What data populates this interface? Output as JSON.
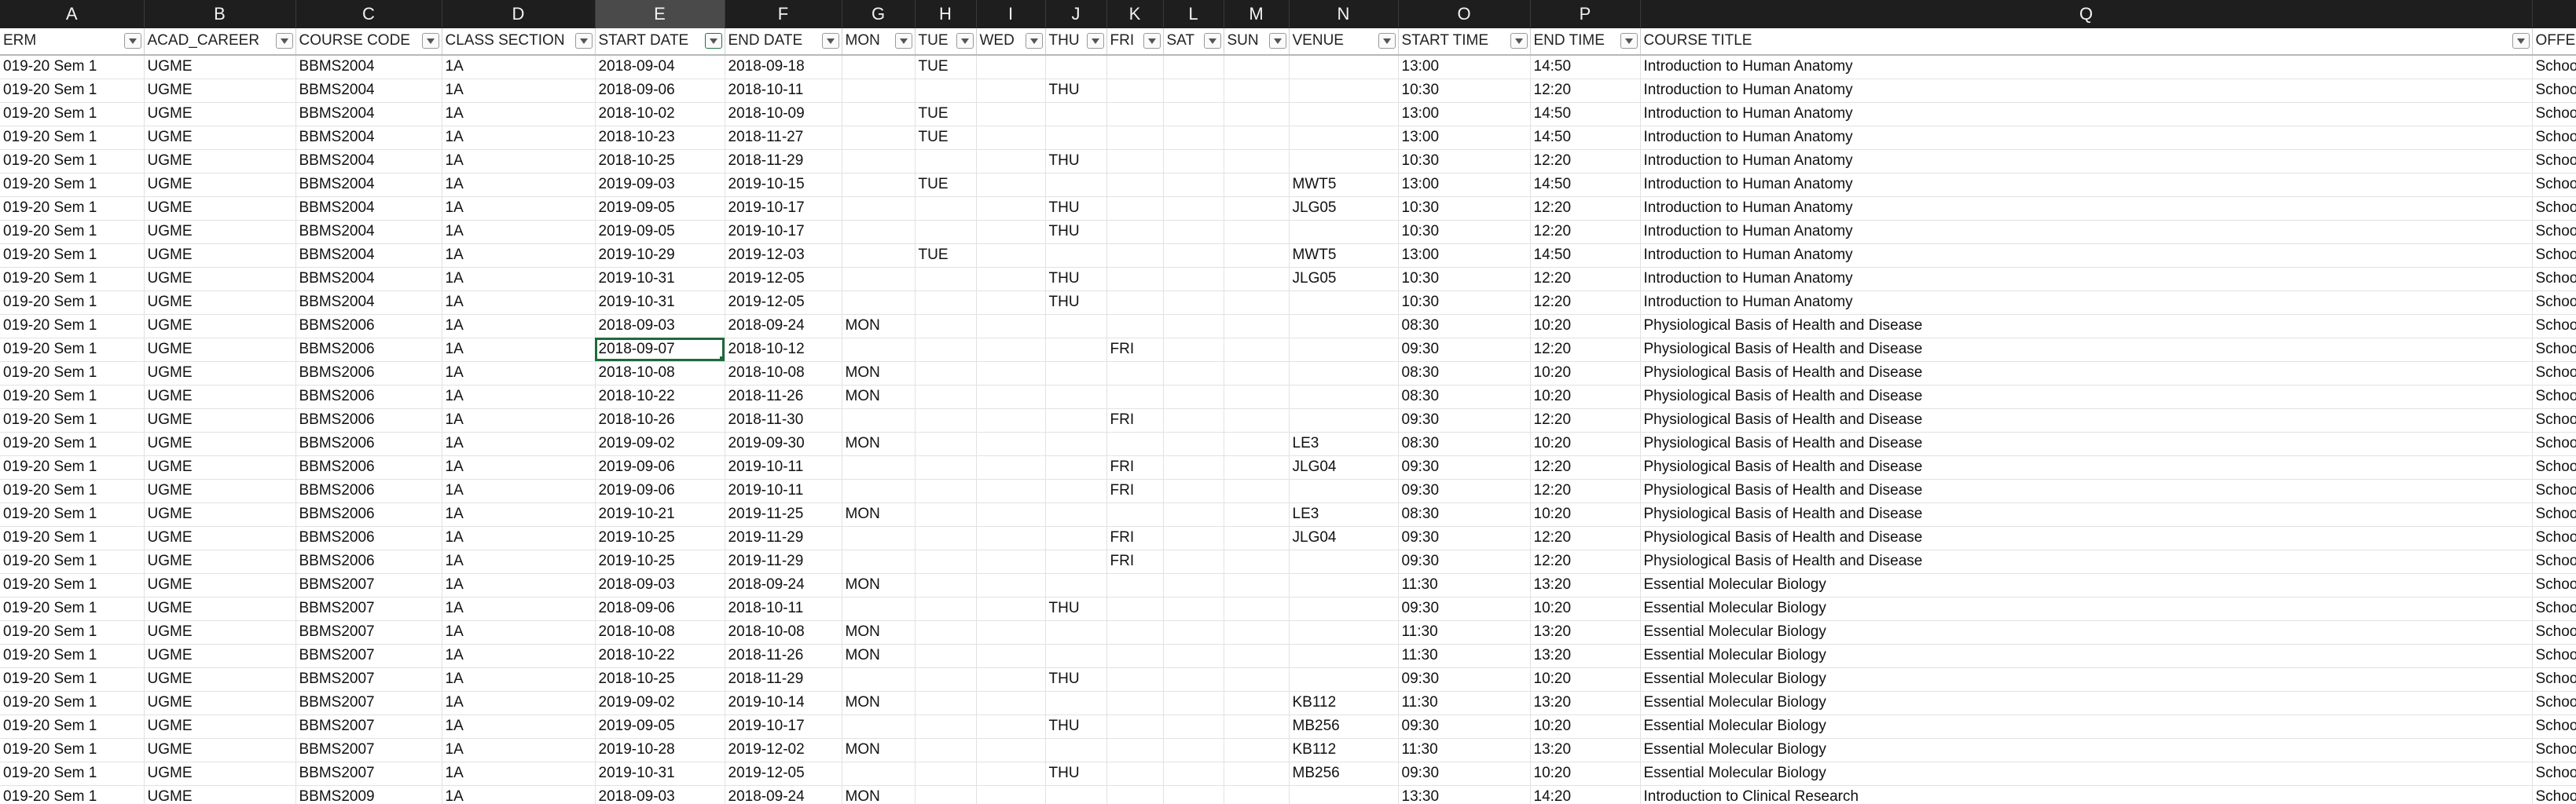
{
  "column_letters": [
    "A",
    "B",
    "C",
    "D",
    "E",
    "F",
    "G",
    "H",
    "I",
    "J",
    "K",
    "L",
    "M",
    "N",
    "O",
    "P",
    "Q",
    ""
  ],
  "selected_column_index": 4,
  "headers": [
    "ERM",
    "ACAD_CAREER",
    "COURSE CODE",
    "CLASS SECTION",
    "START DATE",
    "END DATE",
    "MON",
    "TUE",
    "WED",
    "THU",
    "FRI",
    "SAT",
    "SUN",
    "VENUE",
    "START TIME",
    "END TIME",
    "COURSE TITLE",
    "OFFER"
  ],
  "active_filter_column_index": 4,
  "active_cell": {
    "row": 12,
    "col": 4
  },
  "rows": [
    [
      "019-20 Sem 1",
      "UGME",
      "BBMS2004",
      "1A",
      "2018-09-04",
      "2018-09-18",
      "",
      "TUE",
      "",
      "",
      "",
      "",
      "",
      "",
      "13:00",
      "14:50",
      "Introduction to Human Anatomy",
      "Schoo"
    ],
    [
      "019-20 Sem 1",
      "UGME",
      "BBMS2004",
      "1A",
      "2018-09-06",
      "2018-10-11",
      "",
      "",
      "",
      "THU",
      "",
      "",
      "",
      "",
      "10:30",
      "12:20",
      "Introduction to Human Anatomy",
      "Schoo"
    ],
    [
      "019-20 Sem 1",
      "UGME",
      "BBMS2004",
      "1A",
      "2018-10-02",
      "2018-10-09",
      "",
      "TUE",
      "",
      "",
      "",
      "",
      "",
      "",
      "13:00",
      "14:50",
      "Introduction to Human Anatomy",
      "Schoo"
    ],
    [
      "019-20 Sem 1",
      "UGME",
      "BBMS2004",
      "1A",
      "2018-10-23",
      "2018-11-27",
      "",
      "TUE",
      "",
      "",
      "",
      "",
      "",
      "",
      "13:00",
      "14:50",
      "Introduction to Human Anatomy",
      "Schoo"
    ],
    [
      "019-20 Sem 1",
      "UGME",
      "BBMS2004",
      "1A",
      "2018-10-25",
      "2018-11-29",
      "",
      "",
      "",
      "THU",
      "",
      "",
      "",
      "",
      "10:30",
      "12:20",
      "Introduction to Human Anatomy",
      "Schoo"
    ],
    [
      "019-20 Sem 1",
      "UGME",
      "BBMS2004",
      "1A",
      "2019-09-03",
      "2019-10-15",
      "",
      "TUE",
      "",
      "",
      "",
      "",
      "",
      "MWT5",
      "13:00",
      "14:50",
      "Introduction to Human Anatomy",
      "Schoo"
    ],
    [
      "019-20 Sem 1",
      "UGME",
      "BBMS2004",
      "1A",
      "2019-09-05",
      "2019-10-17",
      "",
      "",
      "",
      "THU",
      "",
      "",
      "",
      "JLG05",
      "10:30",
      "12:20",
      "Introduction to Human Anatomy",
      "Schoo"
    ],
    [
      "019-20 Sem 1",
      "UGME",
      "BBMS2004",
      "1A",
      "2019-09-05",
      "2019-10-17",
      "",
      "",
      "",
      "THU",
      "",
      "",
      "",
      "",
      "10:30",
      "12:20",
      "Introduction to Human Anatomy",
      "Schoo"
    ],
    [
      "019-20 Sem 1",
      "UGME",
      "BBMS2004",
      "1A",
      "2019-10-29",
      "2019-12-03",
      "",
      "TUE",
      "",
      "",
      "",
      "",
      "",
      "MWT5",
      "13:00",
      "14:50",
      "Introduction to Human Anatomy",
      "Schoo"
    ],
    [
      "019-20 Sem 1",
      "UGME",
      "BBMS2004",
      "1A",
      "2019-10-31",
      "2019-12-05",
      "",
      "",
      "",
      "THU",
      "",
      "",
      "",
      "JLG05",
      "10:30",
      "12:20",
      "Introduction to Human Anatomy",
      "Schoo"
    ],
    [
      "019-20 Sem 1",
      "UGME",
      "BBMS2004",
      "1A",
      "2019-10-31",
      "2019-12-05",
      "",
      "",
      "",
      "THU",
      "",
      "",
      "",
      "",
      "10:30",
      "12:20",
      "Introduction to Human Anatomy",
      "Schoo"
    ],
    [
      "019-20 Sem 1",
      "UGME",
      "BBMS2006",
      "1A",
      "2018-09-03",
      "2018-09-24",
      "MON",
      "",
      "",
      "",
      "",
      "",
      "",
      "",
      "08:30",
      "10:20",
      "Physiological Basis of Health and Disease",
      "Schoo"
    ],
    [
      "019-20 Sem 1",
      "UGME",
      "BBMS2006",
      "1A",
      "2018-09-07",
      "2018-10-12",
      "",
      "",
      "",
      "",
      "FRI",
      "",
      "",
      "",
      "09:30",
      "12:20",
      "Physiological Basis of Health and Disease",
      "Schoo"
    ],
    [
      "019-20 Sem 1",
      "UGME",
      "BBMS2006",
      "1A",
      "2018-10-08",
      "2018-10-08",
      "MON",
      "",
      "",
      "",
      "",
      "",
      "",
      "",
      "08:30",
      "10:20",
      "Physiological Basis of Health and Disease",
      "Schoo"
    ],
    [
      "019-20 Sem 1",
      "UGME",
      "BBMS2006",
      "1A",
      "2018-10-22",
      "2018-11-26",
      "MON",
      "",
      "",
      "",
      "",
      "",
      "",
      "",
      "08:30",
      "10:20",
      "Physiological Basis of Health and Disease",
      "Schoo"
    ],
    [
      "019-20 Sem 1",
      "UGME",
      "BBMS2006",
      "1A",
      "2018-10-26",
      "2018-11-30",
      "",
      "",
      "",
      "",
      "FRI",
      "",
      "",
      "",
      "09:30",
      "12:20",
      "Physiological Basis of Health and Disease",
      "Schoo"
    ],
    [
      "019-20 Sem 1",
      "UGME",
      "BBMS2006",
      "1A",
      "2019-09-02",
      "2019-09-30",
      "MON",
      "",
      "",
      "",
      "",
      "",
      "",
      "LE3",
      "08:30",
      "10:20",
      "Physiological Basis of Health and Disease",
      "Schoo"
    ],
    [
      "019-20 Sem 1",
      "UGME",
      "BBMS2006",
      "1A",
      "2019-09-06",
      "2019-10-11",
      "",
      "",
      "",
      "",
      "FRI",
      "",
      "",
      "JLG04",
      "09:30",
      "12:20",
      "Physiological Basis of Health and Disease",
      "Schoo"
    ],
    [
      "019-20 Sem 1",
      "UGME",
      "BBMS2006",
      "1A",
      "2019-09-06",
      "2019-10-11",
      "",
      "",
      "",
      "",
      "FRI",
      "",
      "",
      "",
      "09:30",
      "12:20",
      "Physiological Basis of Health and Disease",
      "Schoo"
    ],
    [
      "019-20 Sem 1",
      "UGME",
      "BBMS2006",
      "1A",
      "2019-10-21",
      "2019-11-25",
      "MON",
      "",
      "",
      "",
      "",
      "",
      "",
      "LE3",
      "08:30",
      "10:20",
      "Physiological Basis of Health and Disease",
      "Schoo"
    ],
    [
      "019-20 Sem 1",
      "UGME",
      "BBMS2006",
      "1A",
      "2019-10-25",
      "2019-11-29",
      "",
      "",
      "",
      "",
      "FRI",
      "",
      "",
      "JLG04",
      "09:30",
      "12:20",
      "Physiological Basis of Health and Disease",
      "Schoo"
    ],
    [
      "019-20 Sem 1",
      "UGME",
      "BBMS2006",
      "1A",
      "2019-10-25",
      "2019-11-29",
      "",
      "",
      "",
      "",
      "FRI",
      "",
      "",
      "",
      "09:30",
      "12:20",
      "Physiological Basis of Health and Disease",
      "Schoo"
    ],
    [
      "019-20 Sem 1",
      "UGME",
      "BBMS2007",
      "1A",
      "2018-09-03",
      "2018-09-24",
      "MON",
      "",
      "",
      "",
      "",
      "",
      "",
      "",
      "11:30",
      "13:20",
      "Essential Molecular Biology",
      "Schoo"
    ],
    [
      "019-20 Sem 1",
      "UGME",
      "BBMS2007",
      "1A",
      "2018-09-06",
      "2018-10-11",
      "",
      "",
      "",
      "THU",
      "",
      "",
      "",
      "",
      "09:30",
      "10:20",
      "Essential Molecular Biology",
      "Schoo"
    ],
    [
      "019-20 Sem 1",
      "UGME",
      "BBMS2007",
      "1A",
      "2018-10-08",
      "2018-10-08",
      "MON",
      "",
      "",
      "",
      "",
      "",
      "",
      "",
      "11:30",
      "13:20",
      "Essential Molecular Biology",
      "Schoo"
    ],
    [
      "019-20 Sem 1",
      "UGME",
      "BBMS2007",
      "1A",
      "2018-10-22",
      "2018-11-26",
      "MON",
      "",
      "",
      "",
      "",
      "",
      "",
      "",
      "11:30",
      "13:20",
      "Essential Molecular Biology",
      "Schoo"
    ],
    [
      "019-20 Sem 1",
      "UGME",
      "BBMS2007",
      "1A",
      "2018-10-25",
      "2018-11-29",
      "",
      "",
      "",
      "THU",
      "",
      "",
      "",
      "",
      "09:30",
      "10:20",
      "Essential Molecular Biology",
      "Schoo"
    ],
    [
      "019-20 Sem 1",
      "UGME",
      "BBMS2007",
      "1A",
      "2019-09-02",
      "2019-10-14",
      "MON",
      "",
      "",
      "",
      "",
      "",
      "",
      "KB112",
      "11:30",
      "13:20",
      "Essential Molecular Biology",
      "Schoo"
    ],
    [
      "019-20 Sem 1",
      "UGME",
      "BBMS2007",
      "1A",
      "2019-09-05",
      "2019-10-17",
      "",
      "",
      "",
      "THU",
      "",
      "",
      "",
      "MB256",
      "09:30",
      "10:20",
      "Essential Molecular Biology",
      "Schoo"
    ],
    [
      "019-20 Sem 1",
      "UGME",
      "BBMS2007",
      "1A",
      "2019-10-28",
      "2019-12-02",
      "MON",
      "",
      "",
      "",
      "",
      "",
      "",
      "KB112",
      "11:30",
      "13:20",
      "Essential Molecular Biology",
      "Schoo"
    ],
    [
      "019-20 Sem 1",
      "UGME",
      "BBMS2007",
      "1A",
      "2019-10-31",
      "2019-12-05",
      "",
      "",
      "",
      "THU",
      "",
      "",
      "",
      "MB256",
      "09:30",
      "10:20",
      "Essential Molecular Biology",
      "Schoo"
    ],
    [
      "019-20 Sem 1",
      "UGME",
      "BBMS2009",
      "1A",
      "2018-09-03",
      "2018-09-24",
      "MON",
      "",
      "",
      "",
      "",
      "",
      "",
      "",
      "13:30",
      "14:20",
      "Introduction to Clinical Research",
      "Schoo"
    ]
  ]
}
